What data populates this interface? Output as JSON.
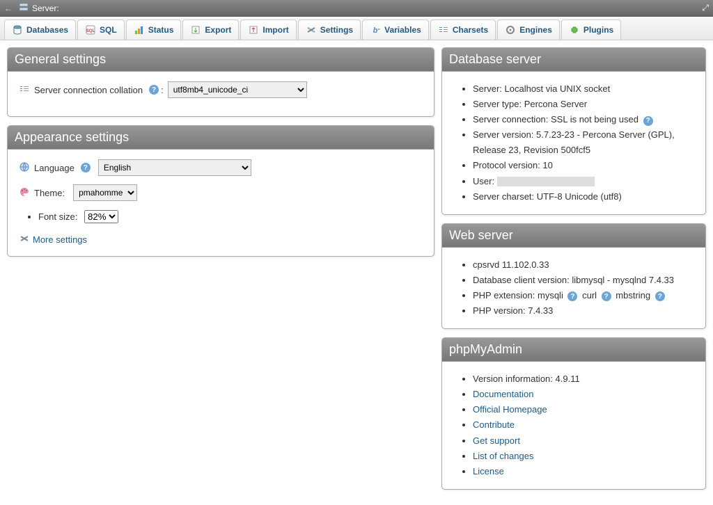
{
  "topbar": {
    "label": "Server:"
  },
  "tabs": [
    {
      "label": "Databases",
      "icon": "database-icon"
    },
    {
      "label": "SQL",
      "icon": "sql-icon"
    },
    {
      "label": "Status",
      "icon": "status-icon"
    },
    {
      "label": "Export",
      "icon": "export-icon"
    },
    {
      "label": "Import",
      "icon": "import-icon"
    },
    {
      "label": "Settings",
      "icon": "settings-icon"
    },
    {
      "label": "Variables",
      "icon": "variables-icon"
    },
    {
      "label": "Charsets",
      "icon": "charsets-icon"
    },
    {
      "label": "Engines",
      "icon": "engines-icon"
    },
    {
      "label": "Plugins",
      "icon": "plugins-icon"
    }
  ],
  "general": {
    "title": "General settings",
    "collation_label": "Server connection collation",
    "collation_value": "utf8mb4_unicode_ci"
  },
  "appearance": {
    "title": "Appearance settings",
    "language_label": "Language",
    "language_value": "English",
    "theme_label": "Theme:",
    "theme_value": "pmahomme",
    "fontsize_label": "Font size:",
    "fontsize_value": "82%",
    "more_settings": "More settings"
  },
  "dbserver": {
    "title": "Database server",
    "items": [
      "Server: Localhost via UNIX socket",
      "Server type: Percona Server",
      "Server connection: SSL is not being used",
      "Server version: 5.7.23-23 - Percona Server (GPL), Release 23, Revision 500fcf5",
      "Protocol version: 10",
      "User:",
      "Server charset: UTF-8 Unicode (utf8)"
    ]
  },
  "webserver": {
    "title": "Web server",
    "item0": "cpsrvd 11.102.0.33",
    "item1": "Database client version: libmysql - mysqlnd 7.4.33",
    "ext_label": "PHP extension:",
    "ext1": "mysqli",
    "ext2": "curl",
    "ext3": "mbstring",
    "item3": "PHP version: 7.4.33"
  },
  "pma": {
    "title": "phpMyAdmin",
    "version": "Version information: 4.9.11",
    "links": [
      "Documentation",
      "Official Homepage",
      "Contribute",
      "Get support",
      "List of changes",
      "License"
    ]
  }
}
